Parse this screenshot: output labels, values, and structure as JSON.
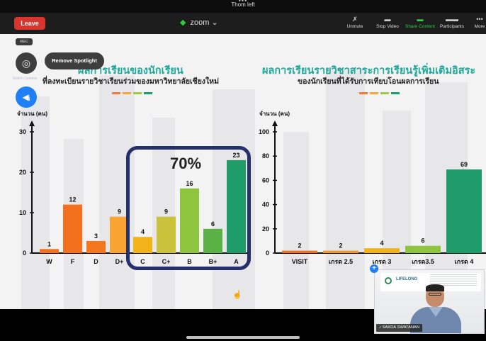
{
  "window": {
    "title": "Thom left"
  },
  "toolbar": {
    "leave_label": "Leave",
    "zoom_label": "zoom",
    "unmute_label": "Unmute",
    "stop_video_label": "Stop Video",
    "share_content_label": "Share Content",
    "participants_label": "Participants",
    "more_label": "More"
  },
  "overlay": {
    "rec_label": "REC",
    "remove_spotlight_label": "Remove Spotlight",
    "switch_camera_label": "Switch Camera"
  },
  "slide": {
    "left_title": "ผลการเรียนของนักเรียน",
    "left_subtitle": "ที่ลงทะเบียนรายวิชาเรียนร่วมของมหาวิทยาลัยเชียงใหม่",
    "right_title": "ผลการเรียนรายวิชาสาระการเรียนรู้เพิ่มเติมอิสระ",
    "right_subtitle": "ของนักเรียนที่ได้รับการเทียบโอนผลการเรียน",
    "highlight_percent": "70%",
    "accent_colors": [
      "#f07f3c",
      "#f4a93a",
      "#9dc84a",
      "#1f9c76"
    ]
  },
  "chart_data": [
    {
      "type": "bar",
      "ylabel": "จำนวน (คน)",
      "ylim": [
        0,
        30
      ],
      "yticks": [
        0,
        10,
        20,
        30
      ],
      "categories": [
        "W",
        "F",
        "D",
        "D+",
        "C",
        "C+",
        "B",
        "B+",
        "A"
      ],
      "values": [
        1,
        12,
        3,
        9,
        4,
        9,
        16,
        6,
        23
      ],
      "colors": [
        "#f3701f",
        "#f3701f",
        "#f3781d",
        "#f9a333",
        "#f2b31a",
        "#c9c23a",
        "#8fc43e",
        "#5ab247",
        "#1f9c6a"
      ]
    },
    {
      "type": "bar",
      "ylabel": "จำนวน (คน)",
      "ylim": [
        0,
        100
      ],
      "yticks": [
        0,
        20,
        40,
        60,
        80,
        100
      ],
      "categories": [
        "VISIT",
        "เกรด 2.5",
        "เกรด 3",
        "เกรด3.5",
        "เกรด 4"
      ],
      "values": [
        2,
        2,
        4,
        6,
        69
      ],
      "colors": [
        "#f3701f",
        "#f49a2e",
        "#f2b31a",
        "#8fc43e",
        "#1f9c6a"
      ]
    }
  ],
  "video": {
    "speaker_name": "SAKDA SWATANAN",
    "logo_text": "LIFELONG"
  }
}
